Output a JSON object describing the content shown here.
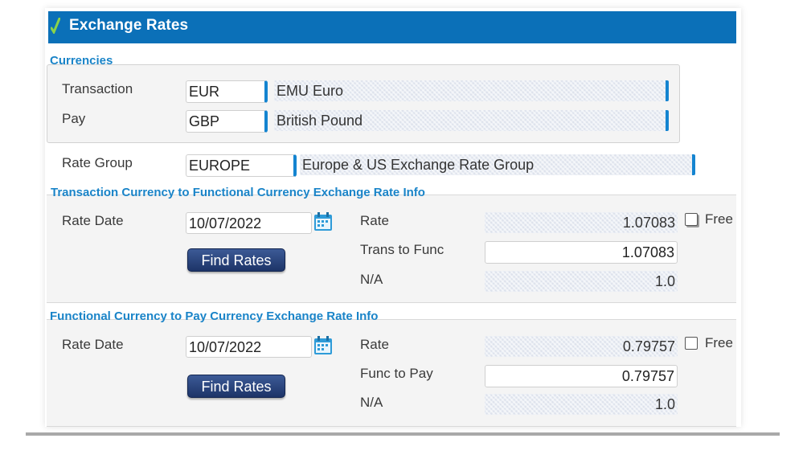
{
  "window": {
    "title": "Exchange Rates"
  },
  "currencies": {
    "section_label": "Currencies",
    "transaction": {
      "label": "Transaction",
      "code": "EUR",
      "description": "EMU Euro"
    },
    "pay": {
      "label": "Pay",
      "code": "GBP",
      "description": "British Pound"
    }
  },
  "rate_group": {
    "label": "Rate Group",
    "code": "EUROPE",
    "description": "Europe & US Exchange Rate Group"
  },
  "trans_to_func": {
    "section_label": "Transaction Currency to Functional Currency Exchange Rate Info",
    "rate_date_label": "Rate Date",
    "rate_date": "10/07/2022",
    "find_rates_label": "Find Rates",
    "rate_label": "Rate",
    "rate_value": "1.07083",
    "free_label": "Free",
    "free_checked": false,
    "conv_label": "Trans to Func",
    "conv_value": "1.07083",
    "na_label": "N/A",
    "na_value": "1.0"
  },
  "func_to_pay": {
    "section_label": "Functional Currency to Pay Currency Exchange Rate Info",
    "rate_date_label": "Rate Date",
    "rate_date": "10/07/2022",
    "find_rates_label": "Find Rates",
    "rate_label": "Rate",
    "rate_value": "0.79757",
    "free_label": "Free",
    "free_checked": false,
    "conv_label": "Func to Pay",
    "conv_value": "0.79757",
    "na_label": "N/A",
    "na_value": "1.0"
  },
  "colors": {
    "title_bar": "#0b70b8",
    "section_label": "#1a84c8",
    "button": "#1d3468",
    "accent_edge": "#1484d0"
  },
  "icons": {
    "title": "check-icon",
    "date": "calendar-icon"
  }
}
